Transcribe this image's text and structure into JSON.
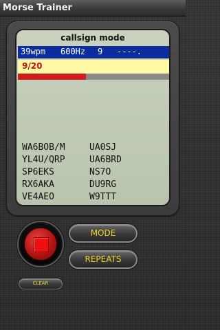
{
  "window": {
    "title": "Morse Trainer"
  },
  "display": {
    "mode_label": "callsign mode",
    "status": {
      "speed": "39wpm",
      "tone": "600Hz",
      "farnsworth": "9",
      "morse": "----."
    },
    "progress": {
      "text": "9/20",
      "current": 9,
      "total": 20
    },
    "callsigns": [
      [
        "WA6BOB/M",
        "UA0SJ"
      ],
      [
        "YL4U/QRP",
        "UA6BRD"
      ],
      [
        "SP6EKS",
        "NS7O"
      ],
      [
        "RX6AKA",
        "DU9RG"
      ],
      [
        "VE4AEO",
        "W9TTT"
      ]
    ]
  },
  "controls": {
    "mode_label": "MODE",
    "repeats_label": "REPEATS",
    "clear_label": "CLEAR",
    "record_button_icon": "stop-icon"
  },
  "colors": {
    "status_bar": "#0d2d9e",
    "progress_bar": "#fff9a6",
    "progress_fill": "#d21b1b",
    "progress_text": "#c01010",
    "button_text": "#f0d42a",
    "record_button": "#d21b1b"
  }
}
